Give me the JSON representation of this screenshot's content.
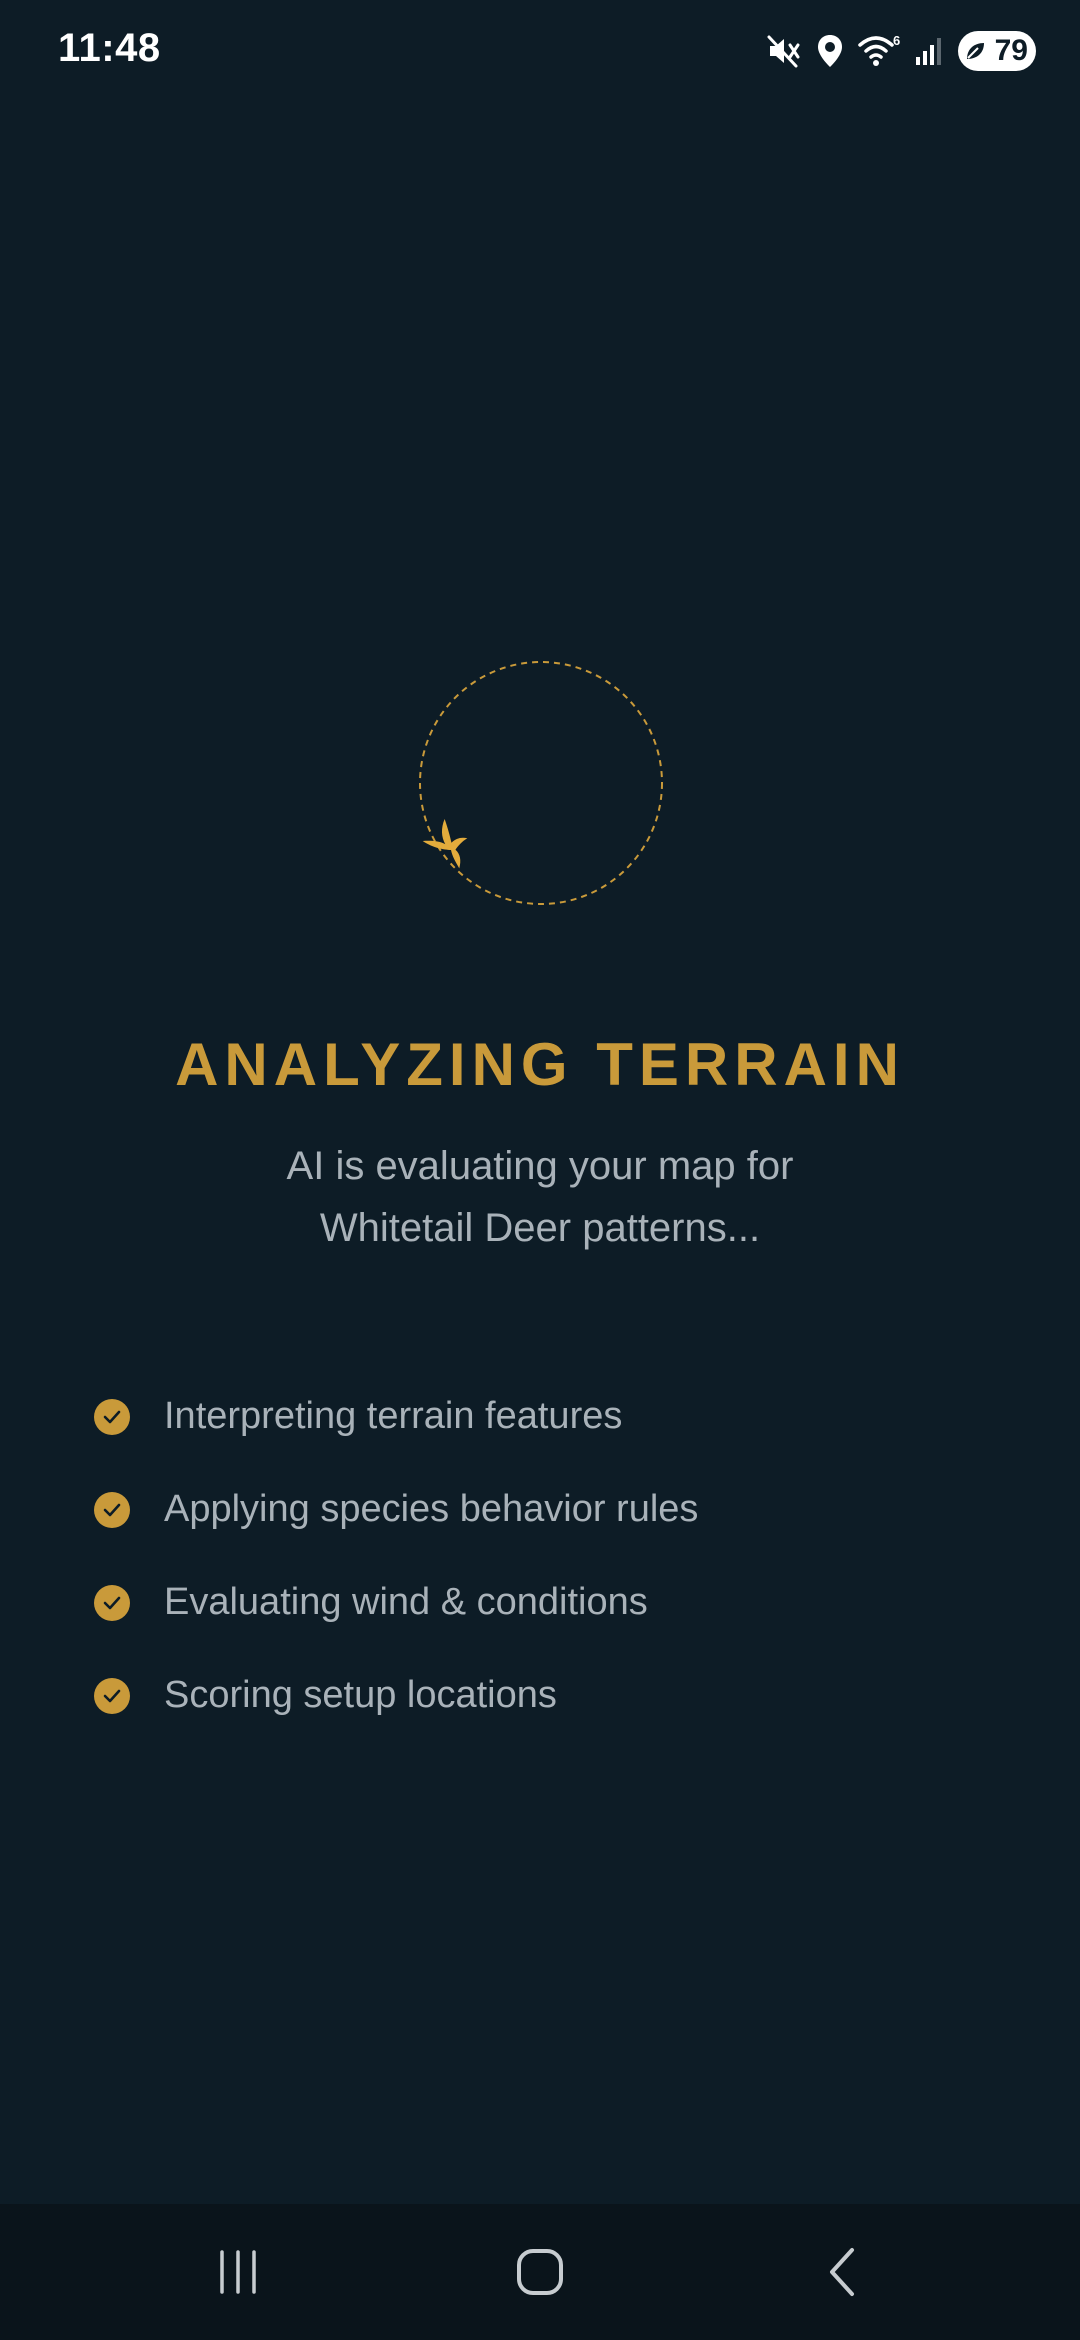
{
  "status_bar": {
    "time": "11:48",
    "battery_level": "79",
    "wifi_badge": "6",
    "icons": [
      "mute-icon",
      "location-icon",
      "wifi-icon",
      "signal-icon",
      "battery-icon"
    ]
  },
  "loader": {
    "icon": "bird-icon",
    "accent_color": "#c99a3a"
  },
  "title": "ANALYZING TERRAIN",
  "subtitle": {
    "line1": "AI is evaluating your map for",
    "line2": "Whitetail Deer patterns..."
  },
  "steps": [
    {
      "label": "Interpreting terrain features",
      "done": true
    },
    {
      "label": "Applying species behavior rules",
      "done": true
    },
    {
      "label": "Evaluating wind & conditions",
      "done": true
    },
    {
      "label": "Scoring setup locations",
      "done": true
    }
  ],
  "nav_bar": {
    "buttons": [
      "recent-apps",
      "home",
      "back"
    ]
  },
  "colors": {
    "background": "#0d1c26",
    "accent": "#c99a3a",
    "text_muted": "#a9b2b9"
  }
}
